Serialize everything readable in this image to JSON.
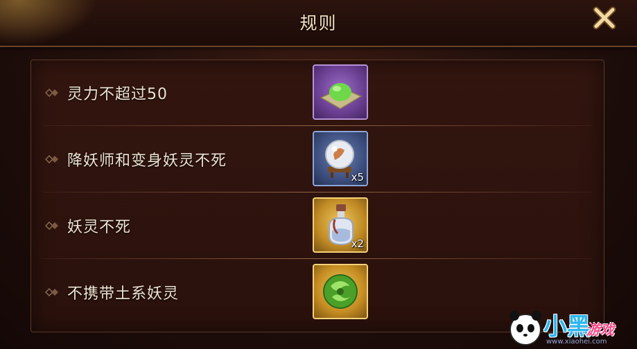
{
  "dialog": {
    "title": "规则",
    "close_icon": "close-x-icon"
  },
  "rules": [
    {
      "text": "灵力不超过50",
      "item_icon": "green-spirit-orb-icon",
      "item_rarity": "purple",
      "count": ""
    },
    {
      "text": "降妖师和变身妖灵不死",
      "item_icon": "crystal-ball-icon",
      "item_rarity": "blue",
      "count": "x5"
    },
    {
      "text": "妖灵不死",
      "item_icon": "potion-bottle-icon",
      "item_rarity": "gold",
      "count": "x2"
    },
    {
      "text": "不携带土系妖灵",
      "item_icon": "green-jade-orb-icon",
      "item_rarity": "gold",
      "count": ""
    }
  ],
  "watermark": {
    "brand_main": "小黑",
    "brand_sub": "游戏",
    "url": "www.xiaohei.com",
    "mascot_icon": "panda-mascot-icon"
  },
  "colors": {
    "title_text": "#f3e2c0",
    "rule_text": "#efe4d2",
    "rarity_purple": "#6a3f92",
    "rarity_blue": "#3e5080",
    "rarity_gold": "#c08a24"
  }
}
